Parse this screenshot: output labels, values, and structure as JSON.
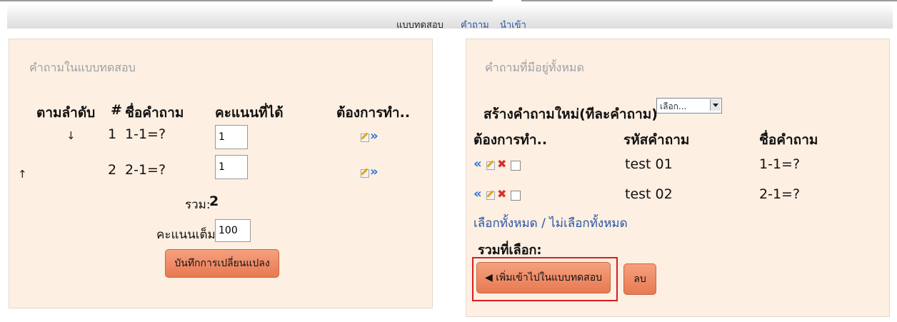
{
  "nav": {
    "items": [
      {
        "label": "แบบทดสอบ",
        "color": "#222222"
      },
      {
        "label": "คำถาม",
        "color": "#2a55a3"
      },
      {
        "label": "นำเข้า",
        "color": "#2a55a3"
      }
    ]
  },
  "left": {
    "title": "คำถามในแบบทดสอบ",
    "headers": {
      "order": "ตามลำดับ",
      "num": "#",
      "name": "ชื่อคำถาม",
      "score": "คะแนนที่ได้",
      "action": "ต้องการทำ.."
    },
    "rows": [
      {
        "num": "1",
        "name": "1-1=?",
        "score": "1",
        "down_arrow": "↓"
      },
      {
        "num": "2",
        "name": "2-1=?",
        "score": "1",
        "up_arrow": "↑"
      }
    ],
    "total_label": "รวม:",
    "total_value": "2",
    "max_label": "คะแนนเต็ม:",
    "max_value": "100",
    "save_button": "บันทึกการเปลี่ยนแปลง"
  },
  "right": {
    "title": "คำถามที่มีอยู่ทั้งหมด",
    "create_label": "สร้างคำถามใหม่(ทีละคำถาม)",
    "create_select": "เลือก...",
    "headers": {
      "action": "ต้องการทำ..",
      "code": "รหัสคำถาม",
      "name": "ชื่อคำถาม"
    },
    "rows": [
      {
        "code": "test 01",
        "name": "1-1=?"
      },
      {
        "code": "test 02",
        "name": "2-1=?"
      }
    ],
    "select_all": "เลือกทั้งหมด / ไม่เลือกทั้งหมด",
    "selected_total": "รวมที่เลือก:",
    "add_button": "◀ เพิ่มเข้าไปในแบบทดสอบ",
    "delete_button": "ลบ"
  },
  "icons": [
    "edit-icon",
    "move-right-icon",
    "move-left-icon",
    "delete-icon",
    "checkbox"
  ],
  "colors": {
    "panel_bg": "#fdefe2",
    "button": "#e77a52",
    "link": "#2a55a3",
    "highlight": "#d81e1e"
  }
}
